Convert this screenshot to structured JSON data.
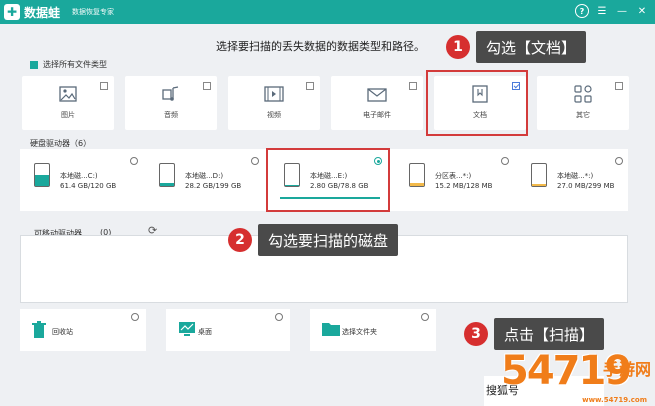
{
  "app": {
    "name": "数据蛙",
    "subtitle": "数据恢复专家"
  },
  "window_controls": [
    "?",
    "☰",
    "—",
    "✕"
  ],
  "headline": "选择要扫描的丢失数据的数据类型和路径。",
  "select_all_label": "选择所有文件类型",
  "file_types": [
    {
      "label": "图片",
      "icon": "image-icon",
      "checked": false
    },
    {
      "label": "音频",
      "icon": "audio-icon",
      "checked": false
    },
    {
      "label": "视频",
      "icon": "video-icon",
      "checked": false
    },
    {
      "label": "电子邮件",
      "icon": "email-icon",
      "checked": false
    },
    {
      "label": "文档",
      "icon": "document-icon",
      "checked": true
    },
    {
      "label": "其它",
      "icon": "other-icon",
      "checked": false
    }
  ],
  "hard_drives_label": "硬盘驱动器（6）",
  "drives": [
    {
      "name": "本地磁...C:)",
      "size": "61.4 GB/120 GB",
      "selected": false,
      "fill_color": "#1aa89c",
      "fill": 0.5
    },
    {
      "name": "本地磁...D:)",
      "size": "28.2 GB/199 GB",
      "selected": false,
      "fill_color": "#1aa89c",
      "fill": 0.15
    },
    {
      "name": "本地磁...E:)",
      "size": "2.80 GB/78.8 GB",
      "selected": true,
      "fill_color": "#1aa89c",
      "fill": 0.04
    },
    {
      "name": "分区表...*:)",
      "size": "15.2 MB/128 MB",
      "selected": false,
      "fill_color": "#f2b94a",
      "fill": 0.12
    },
    {
      "name": "本地磁...*:)",
      "size": "27.0 MB/299 MB",
      "selected": false,
      "fill_color": "#f2b94a",
      "fill": 0.1
    }
  ],
  "removable_label": "可移动驱动器",
  "removable_count": "(0)",
  "locations": [
    {
      "label": "回收站",
      "icon": "recycle-bin-icon"
    },
    {
      "label": "桌面",
      "icon": "desktop-icon"
    },
    {
      "label": "选择文件夹",
      "icon": "folder-icon"
    }
  ],
  "callouts": [
    {
      "num": "1",
      "text": "勾选【文档】"
    },
    {
      "num": "2",
      "text": "勾选要扫描的磁盘"
    },
    {
      "num": "3",
      "text": "点击【扫描】"
    }
  ],
  "scan_button_partial": "搜狐号",
  "watermark": {
    "big": "54719",
    "small": "手游网",
    "url": "www.54719.com"
  }
}
